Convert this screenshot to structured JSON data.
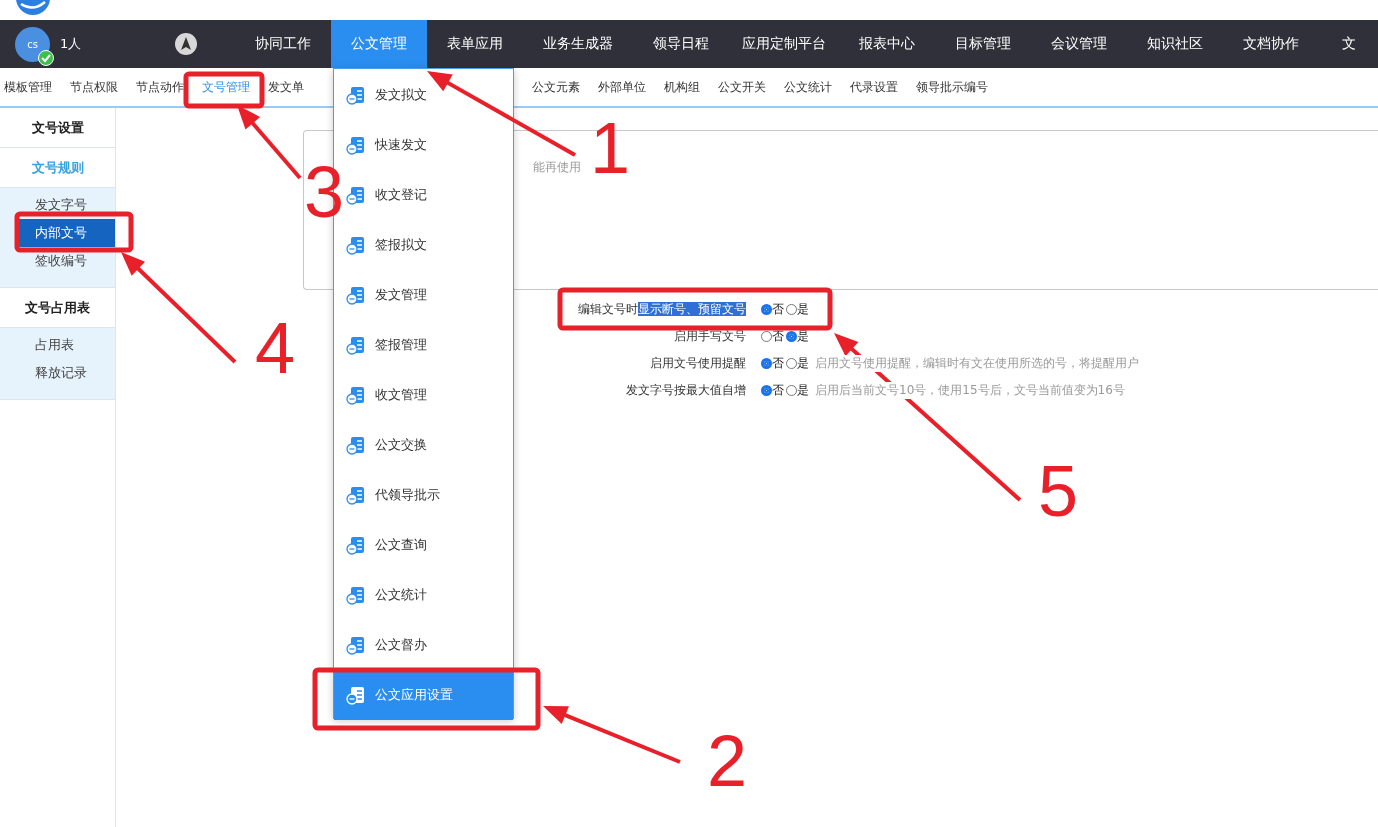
{
  "user": {
    "initials": "cs",
    "count": "1人",
    "online": true
  },
  "nav": [
    {
      "label": "协同工作",
      "selected": false
    },
    {
      "label": "公文管理",
      "selected": true
    },
    {
      "label": "表单应用",
      "selected": false
    },
    {
      "label": "业务生成器",
      "selected": false
    },
    {
      "label": "领导日程",
      "selected": false
    },
    {
      "label": "应用定制平台",
      "selected": false
    },
    {
      "label": "报表中心",
      "selected": false
    },
    {
      "label": "目标管理",
      "selected": false
    },
    {
      "label": "会议管理",
      "selected": false
    },
    {
      "label": "知识社区",
      "selected": false
    },
    {
      "label": "文档协作",
      "selected": false
    },
    {
      "label": "文",
      "selected": false
    }
  ],
  "sub_tabs": [
    {
      "label": "模板管理",
      "selected": false
    },
    {
      "label": "节点权限",
      "selected": false
    },
    {
      "label": "节点动作",
      "selected": false
    },
    {
      "label": "文号管理",
      "selected": true
    },
    {
      "label": "发文单",
      "selected": false
    },
    {
      "label": "公文元素",
      "selected": false
    },
    {
      "label": "外部单位",
      "selected": false
    },
    {
      "label": "机构组",
      "selected": false
    },
    {
      "label": "公文开关",
      "selected": false
    },
    {
      "label": "公文统计",
      "selected": false
    },
    {
      "label": "代录设置",
      "selected": false
    },
    {
      "label": "领导批示编号",
      "selected": false
    }
  ],
  "sidebar": [
    {
      "title": "文号设置",
      "kind": "header",
      "selected": false
    },
    {
      "title": "文号规则",
      "kind": "header",
      "selected": true,
      "children": [
        {
          "label": "发文字号",
          "selected": false
        },
        {
          "label": "内部文号",
          "selected": true
        },
        {
          "label": "签收编号",
          "selected": false
        }
      ]
    },
    {
      "title": "文号占用表",
      "kind": "header",
      "selected": false,
      "children": [
        {
          "label": "占用表",
          "selected": false
        },
        {
          "label": "释放记录",
          "selected": false
        }
      ]
    }
  ],
  "fieldset": {
    "hint": "能再使用"
  },
  "settings": [
    {
      "label": "编辑文号时",
      "selected_text": "显示断号、预留文号",
      "options": [
        {
          "label": "否",
          "selected": true
        },
        {
          "label": "是",
          "selected": false
        }
      ]
    },
    {
      "label": "启用手写文号",
      "options": [
        {
          "label": "否",
          "selected": false
        },
        {
          "label": "是",
          "selected": true
        }
      ]
    },
    {
      "label": "启用文号使用提醒",
      "options": [
        {
          "label": "否",
          "selected": true
        },
        {
          "label": "是",
          "selected": false
        }
      ],
      "hint": "启用文号使用提醒，编辑时有文在使用所选的号，将提醒用户"
    },
    {
      "label": "发文字号按最大值自增",
      "options": [
        {
          "label": "否",
          "selected": true
        },
        {
          "label": "是",
          "selected": false
        }
      ],
      "hint": "启用后当前文号10号，使用15号后，文号当前值变为16号"
    }
  ],
  "dropdown": [
    {
      "label": "发文拟文",
      "selected": false
    },
    {
      "label": "快速发文",
      "selected": false
    },
    {
      "label": "收文登记",
      "selected": false
    },
    {
      "label": "签报拟文",
      "selected": false
    },
    {
      "label": "发文管理",
      "selected": false
    },
    {
      "label": "签报管理",
      "selected": false
    },
    {
      "label": "收文管理",
      "selected": false
    },
    {
      "label": "公文交换",
      "selected": false
    },
    {
      "label": "代领导批示",
      "selected": false
    },
    {
      "label": "公文查询",
      "selected": false
    },
    {
      "label": "公文统计",
      "selected": false
    },
    {
      "label": "公文督办",
      "selected": false
    },
    {
      "label": "公文应用设置",
      "selected": true
    }
  ],
  "annotations": [
    {
      "number": "1"
    },
    {
      "number": "2"
    },
    {
      "number": "3"
    },
    {
      "number": "4"
    },
    {
      "number": "5"
    }
  ]
}
